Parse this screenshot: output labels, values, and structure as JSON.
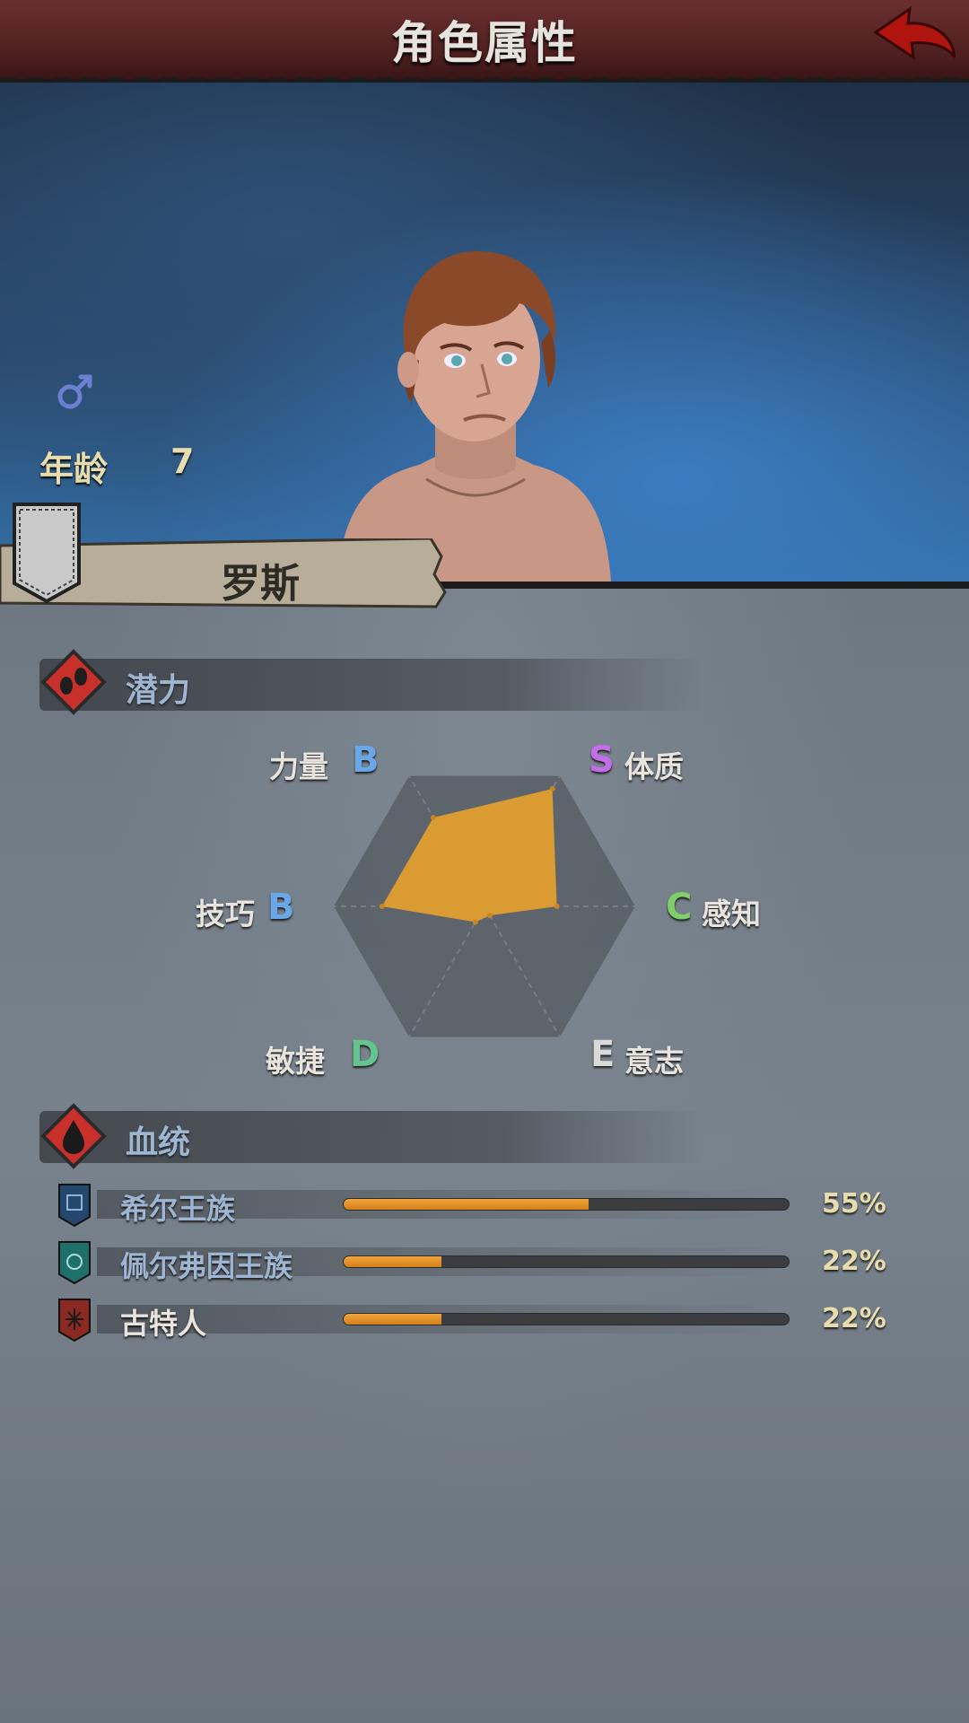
{
  "header": {
    "title": "角色属性",
    "back_icon": "back-arrow-icon"
  },
  "profile": {
    "gender_icon": "male-symbol-icon",
    "age_label": "年龄",
    "age_value": "7",
    "name": "罗斯"
  },
  "potential": {
    "title": "潜力",
    "icon": "footprint-icon",
    "attributes": [
      {
        "label": "力量",
        "grade": "B",
        "grade_color": "#6aa7e6"
      },
      {
        "label": "体质",
        "grade": "S",
        "grade_color": "#c36ee8"
      },
      {
        "label": "感知",
        "grade": "C",
        "grade_color": "#7fce6a"
      },
      {
        "label": "意志",
        "grade": "E",
        "grade_color": "#d9d9d9"
      },
      {
        "label": "敏捷",
        "grade": "D",
        "grade_color": "#64c48e"
      },
      {
        "label": "技巧",
        "grade": "B",
        "grade_color": "#6aa7e6"
      }
    ],
    "fill_color": "#e09e2f"
  },
  "chart_data": {
    "type": "radar",
    "axes": [
      "力量",
      "体质",
      "感知",
      "意志",
      "敏捷",
      "技巧"
    ],
    "grades": [
      "B",
      "S",
      "C",
      "E",
      "D",
      "B"
    ],
    "values": [
      0.68,
      0.9,
      0.48,
      0.07,
      0.12,
      0.68
    ],
    "max": 1
  },
  "bloodline": {
    "title": "血统",
    "icon": "blood-drop-icon",
    "items": [
      {
        "name": "希尔王族",
        "percent": "55%",
        "value": 0.55,
        "name_color": "#9fb6d3",
        "icon": "shield-crest-blue-icon",
        "icon_color": "#24476e"
      },
      {
        "name": "佩尔弗因王族",
        "percent": "22%",
        "value": 0.22,
        "name_color": "#9fb6d3",
        "icon": "shield-crest-teal-icon",
        "icon_color": "#1f6f6a"
      },
      {
        "name": "古特人",
        "percent": "22%",
        "value": 0.22,
        "name_color": "#e8e4de",
        "icon": "shield-crest-red-icon",
        "icon_color": "#8a2a22"
      }
    ]
  }
}
